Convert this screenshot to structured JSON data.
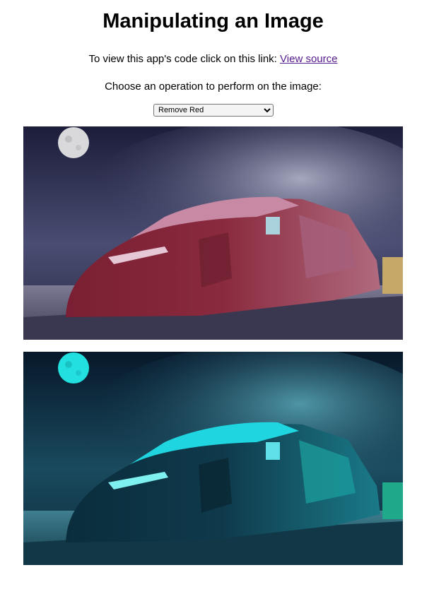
{
  "page": {
    "title": "Manipulating an Image",
    "source_text": "To view this app's code click on this link:",
    "source_link": "View source",
    "prompt": "Choose an operation to perform on the image:"
  },
  "operation_select": {
    "selected": "Remove Red"
  },
  "images": {
    "original": {
      "description_icon": "train-photo",
      "colors": {
        "sky_top": "#1c1d3a",
        "sky_mid": "#4a4d72",
        "cloud": "#8f92b0",
        "train_body": "#8a2a3e",
        "train_highlight": "#c889a4",
        "platform": "#5f5d7a",
        "moon": "#d9d9dc"
      }
    },
    "result": {
      "description_icon": "train-photo-red-removed",
      "colors": {
        "sky_top": "#07182a",
        "sky_mid": "#1a4a5e",
        "cloud": "#4a8a98",
        "train_body": "#0f3a4c",
        "train_highlight": "#1fd6e0",
        "platform": "#2f5f70",
        "moon": "#22e0e0"
      }
    }
  }
}
